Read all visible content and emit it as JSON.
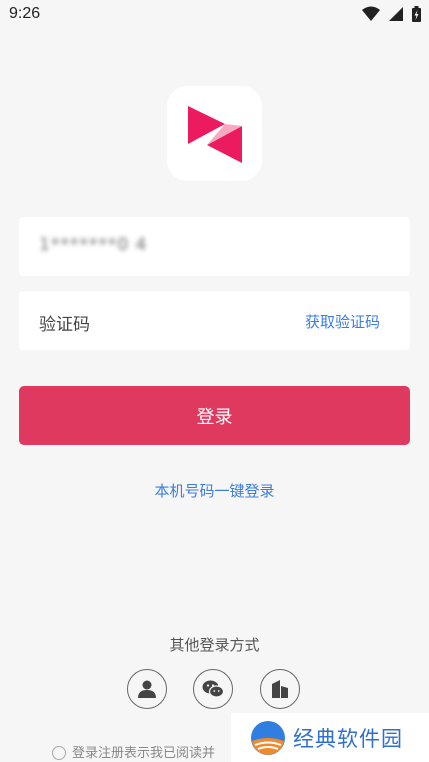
{
  "status_bar": {
    "time": "9:26"
  },
  "login": {
    "phone_value": "1*******0 4",
    "code_placeholder": "验证码",
    "get_code_label": "获取验证码",
    "login_button_label": "登录",
    "one_click_login_label": "本机号码一键登录"
  },
  "other_login": {
    "title": "其他登录方式",
    "methods": [
      "account-icon",
      "wechat-icon",
      "building-icon"
    ]
  },
  "agreement": {
    "text": "登录注册表示我已阅读并"
  },
  "watermark": {
    "text": "经典软件园"
  },
  "colors": {
    "accent": "#e0395f",
    "link": "#3b7de0",
    "background": "#f6f6f7"
  }
}
